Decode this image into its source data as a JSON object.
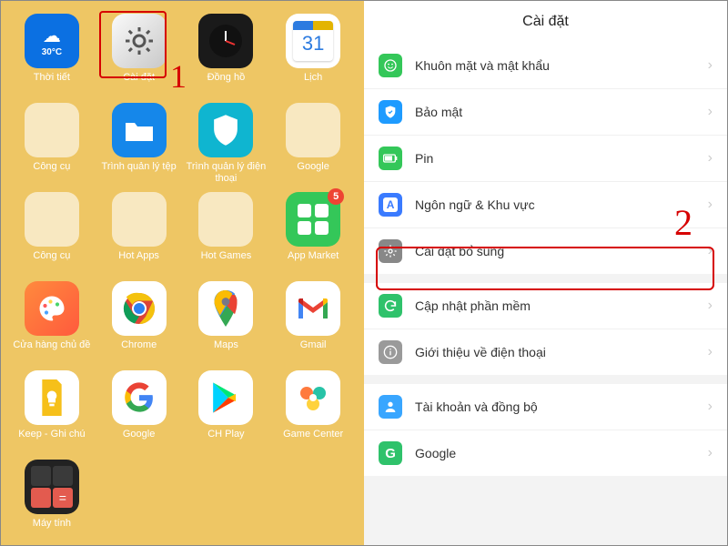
{
  "annotations": {
    "step1": "1",
    "step2": "2"
  },
  "home": {
    "apps": [
      {
        "name": "weather",
        "label": "Thời tiết",
        "badge": null
      },
      {
        "name": "settings",
        "label": "Cài đặt",
        "badge": null
      },
      {
        "name": "clock",
        "label": "Đồng hồ",
        "badge": null
      },
      {
        "name": "calendar",
        "label": "Lịch",
        "badge": null,
        "day": "31"
      },
      {
        "name": "tools",
        "label": "Công cụ",
        "badge": null
      },
      {
        "name": "files",
        "label": "Trình quản lý tệp",
        "badge": null
      },
      {
        "name": "phonemgr",
        "label": "Trình quản lý điện thoại",
        "badge": null
      },
      {
        "name": "googlefld",
        "label": "Google",
        "badge": null
      },
      {
        "name": "tools2",
        "label": "Công cụ",
        "badge": null
      },
      {
        "name": "hotapps",
        "label": "Hot Apps",
        "badge": null
      },
      {
        "name": "hotgames",
        "label": "Hot Games",
        "badge": null
      },
      {
        "name": "appmarket",
        "label": "App Market",
        "badge": "5"
      },
      {
        "name": "themes",
        "label": "Cửa hàng chủ đề",
        "badge": null
      },
      {
        "name": "chrome",
        "label": "Chrome",
        "badge": null
      },
      {
        "name": "maps",
        "label": "Maps",
        "badge": null
      },
      {
        "name": "gmail",
        "label": "Gmail",
        "badge": null
      },
      {
        "name": "keep",
        "label": "Keep - Ghi chú",
        "badge": null
      },
      {
        "name": "google",
        "label": "Google",
        "badge": null
      },
      {
        "name": "chplay",
        "label": "CH Play",
        "badge": null
      },
      {
        "name": "gamecenter",
        "label": "Game Center",
        "badge": null
      },
      {
        "name": "calculator",
        "label": "Máy tính",
        "badge": null
      }
    ],
    "weather_temp": "30°C"
  },
  "settings": {
    "title": "Cài đặt",
    "groups": [
      [
        {
          "name": "face-password",
          "label": "Khuôn mặt và mật khẩu",
          "color": "#34c759",
          "glyph": "face"
        },
        {
          "name": "security",
          "label": "Bảo mật",
          "color": "#1e9bff",
          "glyph": "shield"
        },
        {
          "name": "battery",
          "label": "Pin",
          "color": "#34c759",
          "glyph": "battery"
        },
        {
          "name": "language",
          "label": "Ngôn ngữ & Khu vực",
          "color": "#3a7bff",
          "glyph": "a"
        },
        {
          "name": "additional",
          "label": "Cài đặt bổ sung",
          "color": "#888",
          "glyph": "gear"
        }
      ],
      [
        {
          "name": "update",
          "label": "Cập nhật phần mềm",
          "color": "#2fc26b",
          "glyph": "refresh"
        },
        {
          "name": "about",
          "label": "Giới thiệu về điện thoại",
          "color": "#9a9a9a",
          "glyph": "info"
        }
      ],
      [
        {
          "name": "accounts",
          "label": "Tài khoản và đồng bộ",
          "color": "#39a6ff",
          "glyph": "user"
        },
        {
          "name": "google",
          "label": "Google",
          "color": "#2fc26b",
          "glyph": "g"
        }
      ]
    ]
  }
}
